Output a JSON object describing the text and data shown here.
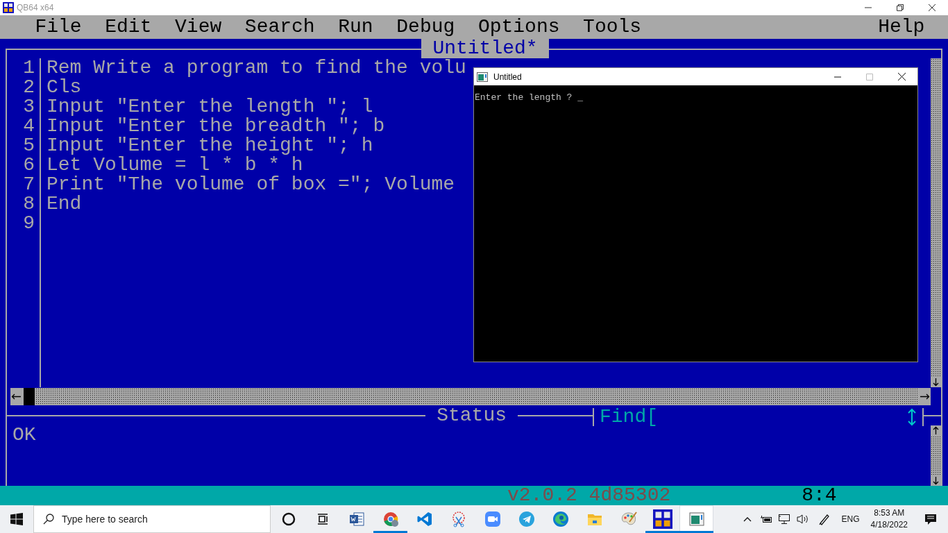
{
  "window": {
    "title": "QB64 x64"
  },
  "menu": {
    "items": [
      {
        "label": "File"
      },
      {
        "label": "Edit"
      },
      {
        "label": "View"
      },
      {
        "label": "Search"
      },
      {
        "label": "Run"
      },
      {
        "label": "Debug"
      },
      {
        "label": "Options"
      },
      {
        "label": "Tools"
      }
    ],
    "right_items": [
      {
        "label": "Help"
      }
    ]
  },
  "editor": {
    "title": "Untitled*",
    "lines": [
      {
        "number": "1",
        "code": "Rem Write a program to find the volu"
      },
      {
        "number": "2",
        "code": "Cls"
      },
      {
        "number": "3",
        "code": "Input \"Enter the length \"; l"
      },
      {
        "number": "4",
        "code": "Input \"Enter the breadth \"; b"
      },
      {
        "number": "5",
        "code": "Input \"Enter the height \"; h"
      },
      {
        "number": "6",
        "code": "Let Volume = l * b * h"
      },
      {
        "number": "7",
        "code": "Print \"The volume of box =\"; Volume"
      },
      {
        "number": "8",
        "code": "End"
      },
      {
        "number": "9"
      }
    ]
  },
  "console_window": {
    "title": "Untitled",
    "output": "Enter the length ? _"
  },
  "status_panel": {
    "title": "Status",
    "message": "OK",
    "find_label": "Find["
  },
  "status_bar": {
    "version": "v2.0.2 4d85302",
    "cursor": "8:4"
  },
  "taskbar": {
    "search": {
      "placeholder": "Type here to search"
    },
    "apps": [
      {
        "kind": "cortana",
        "running": false,
        "selected": false
      },
      {
        "kind": "taskview",
        "running": false,
        "selected": false
      },
      {
        "kind": "word",
        "running": false,
        "selected": false
      },
      {
        "kind": "chrome",
        "running": true,
        "selected": false
      },
      {
        "kind": "vscode",
        "running": false,
        "selected": false
      },
      {
        "kind": "snip",
        "running": false,
        "selected": false
      },
      {
        "kind": "zoom",
        "running": false,
        "selected": false
      },
      {
        "kind": "telegram",
        "running": false,
        "selected": false
      },
      {
        "kind": "edge",
        "running": false,
        "selected": false
      },
      {
        "kind": "explorer",
        "running": false,
        "selected": false
      },
      {
        "kind": "paint",
        "running": false,
        "selected": false
      },
      {
        "kind": "qb64",
        "running": true,
        "selected": false
      },
      {
        "kind": "console",
        "running": true,
        "selected": true
      }
    ],
    "tray": {
      "language": "ENG",
      "time": "8:53 AM",
      "date": "4/18/2022"
    }
  }
}
